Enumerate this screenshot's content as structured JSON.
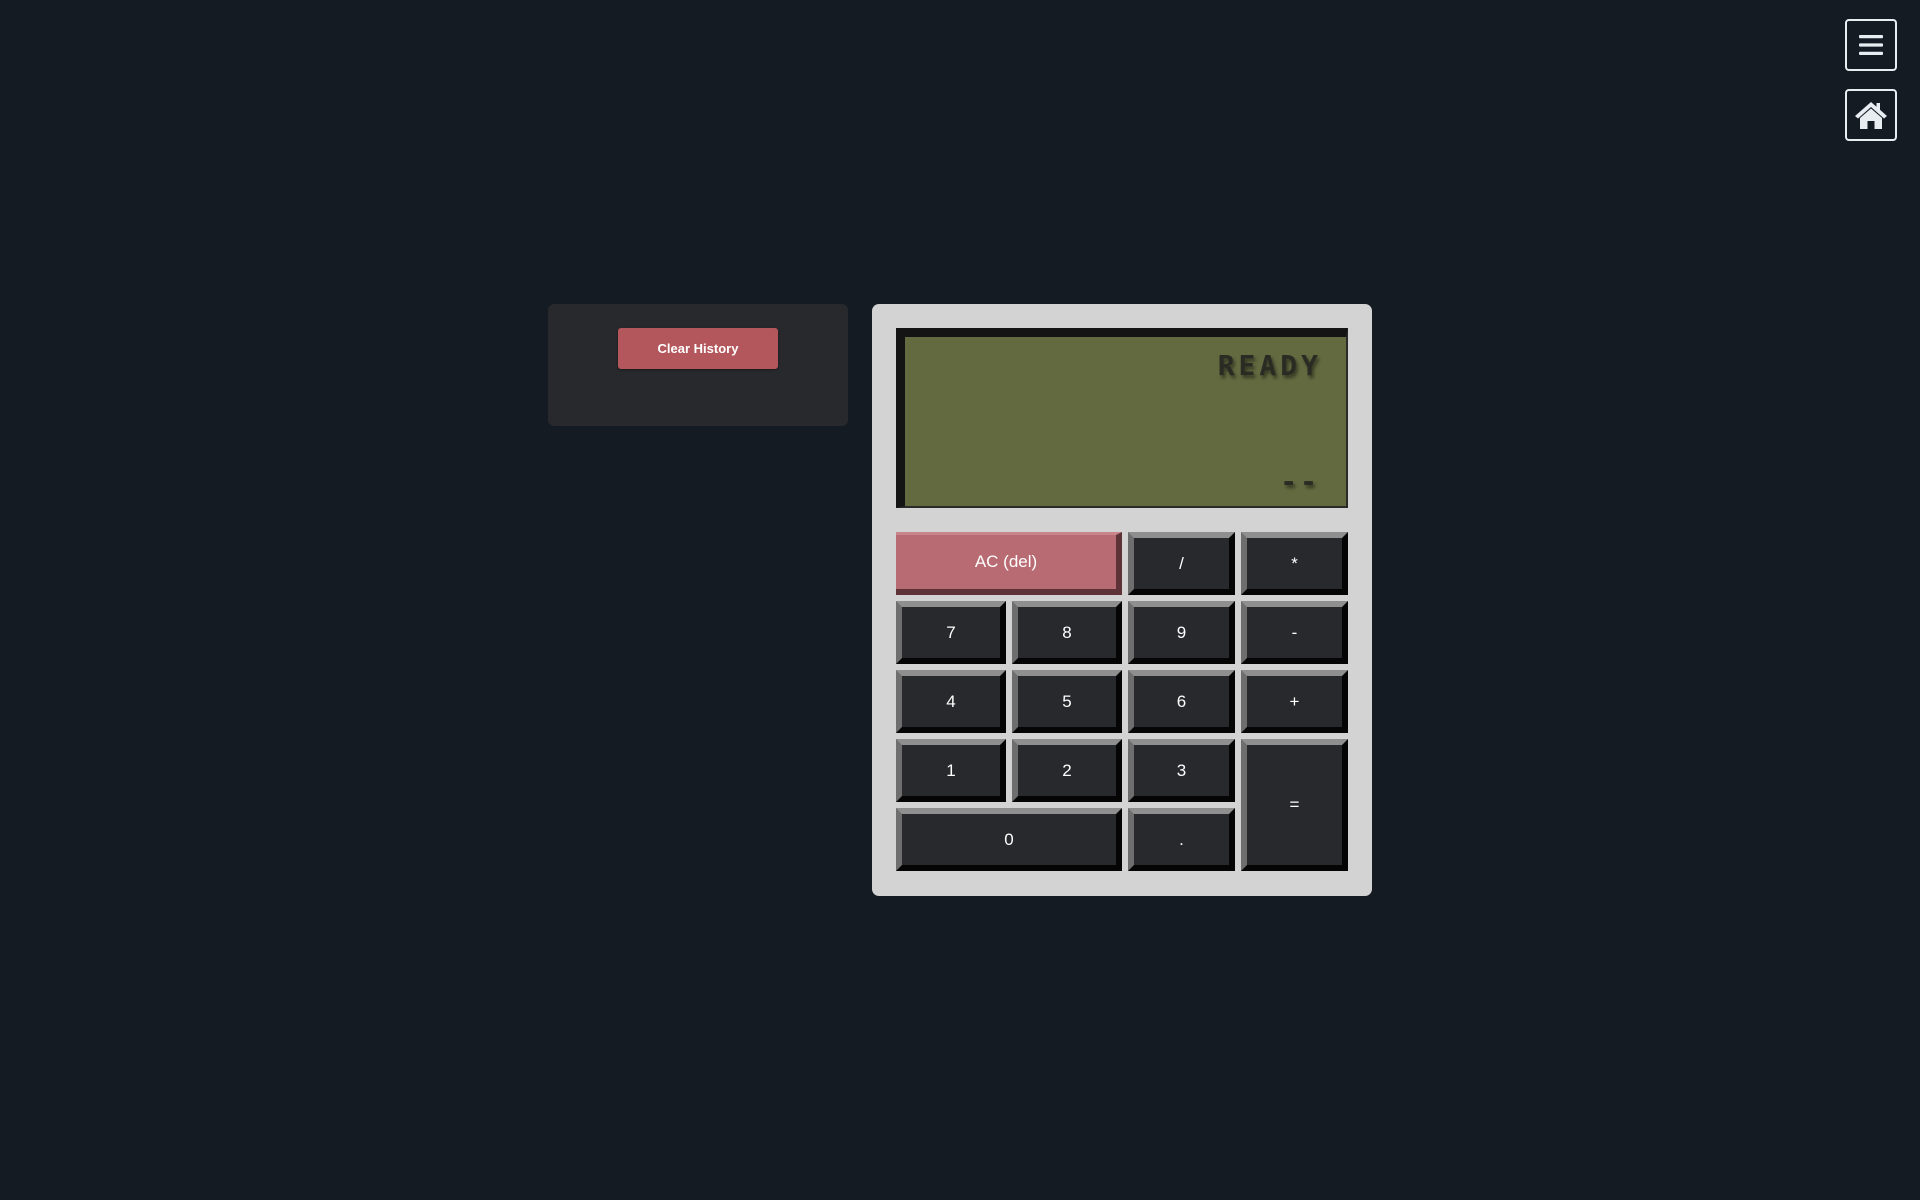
{
  "nav": {
    "menu_icon": "hamburger-menu-icon",
    "home_icon": "home-icon"
  },
  "history": {
    "clear_label": "Clear History"
  },
  "display": {
    "status": "READY",
    "value": "--"
  },
  "keys": {
    "ac": "AC (del)",
    "divide": "/",
    "multiply": "*",
    "seven": "7",
    "eight": "8",
    "nine": "9",
    "subtract": "-",
    "four": "4",
    "five": "5",
    "six": "6",
    "add": "+",
    "one": "1",
    "two": "2",
    "three": "3",
    "equals": "=",
    "zero": "0",
    "decimal": "."
  },
  "colors": {
    "background": "#141b23",
    "history_panel": "#28292c",
    "clear_button": "#b4575c",
    "calculator_body": "#d3d3d3",
    "lcd_screen": "#636a40",
    "key": "#28292c",
    "ac_key": "#b86b72"
  }
}
